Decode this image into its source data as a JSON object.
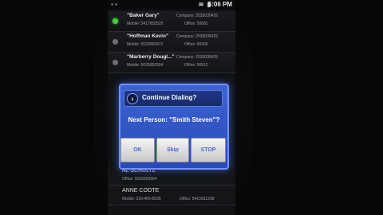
{
  "status_bar": {
    "left_icons": "▪ ▪",
    "right_icons": "≋ ▮",
    "time": "5:06 PM"
  },
  "contacts": [
    {
      "name": "\"Baker Gary\"",
      "mobile": "Mobile: 5417955525",
      "company": "Company: 2535035425",
      "office": "Office: 50681",
      "active": true
    },
    {
      "name": "\"Hoffman Kevin\"",
      "mobile": "Mobile: 5529655472",
      "company": "Company: 2535035425",
      "office": "Office: 50405",
      "active": false
    },
    {
      "name": "\"Marberry Dougl...\"",
      "mobile": "Mobile: 5035052504",
      "company": "Company: 2535035425",
      "office": "Office: 50512",
      "active": false
    }
  ],
  "contacts_below": [
    {
      "name": "AL SCHULTZ",
      "office": "Office: 5035550654"
    },
    {
      "name": "ANNE COOTE",
      "mobile": "Mobile: 518-406-0035",
      "office": "Office: 5415631299"
    }
  ],
  "dialog": {
    "title": "Continue Dialing?",
    "message": "Next Person: \"Smith Steven\"?",
    "ok_label": "OK",
    "skip_label": "Skip",
    "stop_label": "STOP"
  },
  "colors": {
    "dialog_bg": "#3d63d2",
    "dialog_border": "#6f92ff",
    "button_text": "#4a67c8",
    "active_dot": "#3fd13a"
  }
}
